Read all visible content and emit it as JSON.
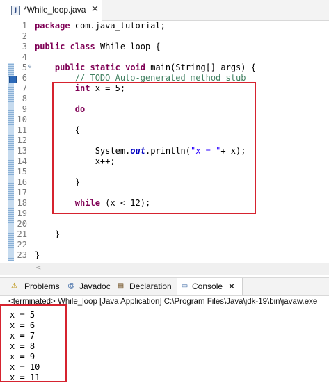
{
  "editor_tab": {
    "title": "*While_loop.java",
    "close": "✕",
    "icon_letter": "J"
  },
  "code_lines": [
    {
      "n": "1",
      "segments": [
        {
          "t": "package",
          "c": "kw"
        },
        {
          "t": " com.java_tutorial;",
          "c": ""
        }
      ]
    },
    {
      "n": "2",
      "segments": []
    },
    {
      "n": "3",
      "segments": [
        {
          "t": "public",
          "c": "kw"
        },
        {
          "t": " ",
          "c": ""
        },
        {
          "t": "class",
          "c": "kw"
        },
        {
          "t": " While_loop {",
          "c": ""
        }
      ]
    },
    {
      "n": "4",
      "segments": []
    },
    {
      "n": "5",
      "segments": [
        {
          "t": "    ",
          "c": ""
        },
        {
          "t": "public",
          "c": "kw"
        },
        {
          "t": " ",
          "c": ""
        },
        {
          "t": "static",
          "c": "kw"
        },
        {
          "t": " ",
          "c": ""
        },
        {
          "t": "void",
          "c": "kw"
        },
        {
          "t": " main(String[] args) {",
          "c": ""
        }
      ]
    },
    {
      "n": "6",
      "segments": [
        {
          "t": "        ",
          "c": ""
        },
        {
          "t": "// TODO Auto-generated method stub",
          "c": "comment"
        }
      ]
    },
    {
      "n": "7",
      "segments": [
        {
          "t": "        ",
          "c": ""
        },
        {
          "t": "int",
          "c": "kw"
        },
        {
          "t": " x = 5;",
          "c": ""
        }
      ]
    },
    {
      "n": "8",
      "segments": []
    },
    {
      "n": "9",
      "segments": [
        {
          "t": "        ",
          "c": ""
        },
        {
          "t": "do",
          "c": "kw"
        }
      ]
    },
    {
      "n": "10",
      "segments": []
    },
    {
      "n": "11",
      "segments": [
        {
          "t": "        {",
          "c": ""
        }
      ]
    },
    {
      "n": "12",
      "segments": []
    },
    {
      "n": "13",
      "segments": [
        {
          "t": "            System.",
          "c": ""
        },
        {
          "t": "out",
          "c": "fieldit"
        },
        {
          "t": ".println(",
          "c": ""
        },
        {
          "t": "\"x = \"",
          "c": "str"
        },
        {
          "t": "+ x);",
          "c": ""
        }
      ]
    },
    {
      "n": "14",
      "segments": [
        {
          "t": "            x++;",
          "c": ""
        }
      ]
    },
    {
      "n": "15",
      "segments": []
    },
    {
      "n": "16",
      "segments": [
        {
          "t": "        }",
          "c": ""
        }
      ]
    },
    {
      "n": "17",
      "segments": []
    },
    {
      "n": "18",
      "segments": [
        {
          "t": "        ",
          "c": ""
        },
        {
          "t": "while",
          "c": "kw"
        },
        {
          "t": " (x < 12);",
          "c": ""
        }
      ]
    },
    {
      "n": "19",
      "segments": []
    },
    {
      "n": "20",
      "segments": []
    },
    {
      "n": "21",
      "segments": [
        {
          "t": "    }",
          "c": ""
        }
      ]
    },
    {
      "n": "22",
      "segments": []
    },
    {
      "n": "23",
      "segments": [
        {
          "t": "}",
          "c": ""
        }
      ]
    }
  ],
  "fold_marker": "⊖",
  "console_tabs": [
    {
      "icon": "problems-icon",
      "glyph": "⚠",
      "label": "Problems",
      "active": false
    },
    {
      "icon": "javadoc-icon",
      "glyph": "@",
      "label": "Javadoc",
      "active": false
    },
    {
      "icon": "declaration-icon",
      "glyph": "▤",
      "label": "Declaration",
      "active": false
    },
    {
      "icon": "console-icon",
      "glyph": "▭",
      "label": "Console",
      "active": true
    }
  ],
  "console_close": "✕",
  "console_header": "<terminated> While_loop [Java Application] C:\\Program Files\\Java\\jdk-19\\bin\\javaw.exe",
  "console_output": [
    "x = 5",
    "x = 6",
    "x = 7",
    "x = 8",
    "x = 9",
    "x = 10",
    "x = 11"
  ],
  "colors": {
    "highlight_box": "#d6232f",
    "keyword": "#7f0055",
    "comment": "#3f7f5f",
    "string": "#2a00ff"
  }
}
